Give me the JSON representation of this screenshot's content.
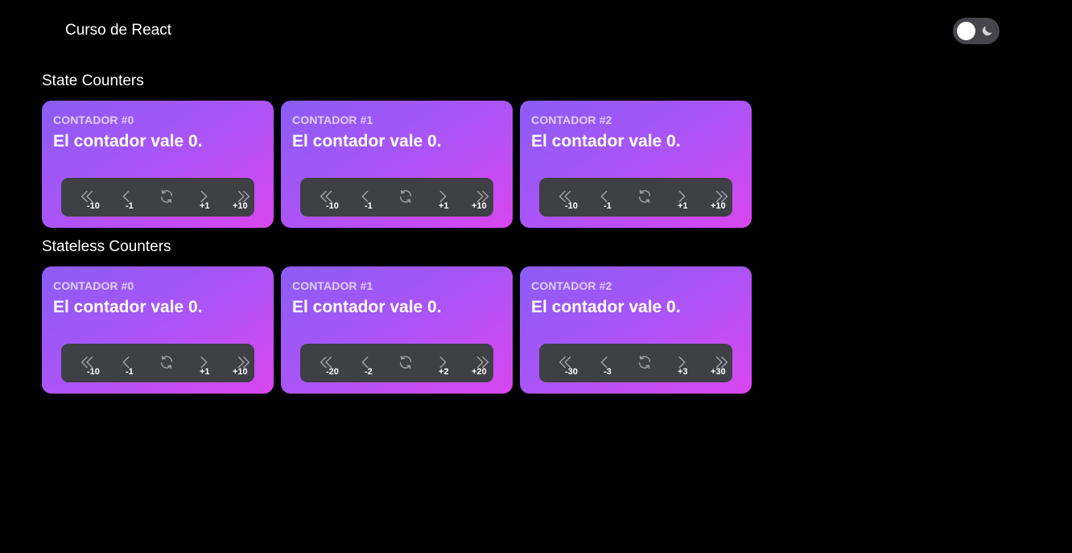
{
  "app": {
    "title": "Curso de React"
  },
  "theme_toggle": {
    "mode": "dark"
  },
  "sections": [
    {
      "title": "State Counters",
      "cards": [
        {
          "label": "CONTADOR #0",
          "text": "El contador vale 0.",
          "steps": [
            "-10",
            "-1",
            "+1",
            "+10"
          ]
        },
        {
          "label": "CONTADOR #1",
          "text": "El contador vale 0.",
          "steps": [
            "-10",
            "-1",
            "+1",
            "+10"
          ]
        },
        {
          "label": "CONTADOR #2",
          "text": "El contador vale 0.",
          "steps": [
            "-10",
            "-1",
            "+1",
            "+10"
          ]
        }
      ]
    },
    {
      "title": "Stateless Counters",
      "cards": [
        {
          "label": "CONTADOR #0",
          "text": "El contador vale 0.",
          "steps": [
            "-10",
            "-1",
            "+1",
            "+10"
          ]
        },
        {
          "label": "CONTADOR #1",
          "text": "El contador vale 0.",
          "steps": [
            "-20",
            "-2",
            "+2",
            "+20"
          ]
        },
        {
          "label": "CONTADOR #2",
          "text": "El contador vale 0.",
          "steps": [
            "-30",
            "-3",
            "+3",
            "+30"
          ]
        }
      ]
    }
  ],
  "colors": {
    "background": "#000000",
    "card_gradient_start": "#8b5cf6",
    "card_gradient_end": "#d946ef",
    "controls_background": "#3f3f46",
    "label_color": "#e2cdfc"
  },
  "icons": {
    "double_left": "chevrons-left-icon",
    "left": "chevron-left-icon",
    "reset": "refresh-icon",
    "right": "chevron-right-icon",
    "double_right": "chevrons-right-icon",
    "theme": "moon-icon"
  }
}
